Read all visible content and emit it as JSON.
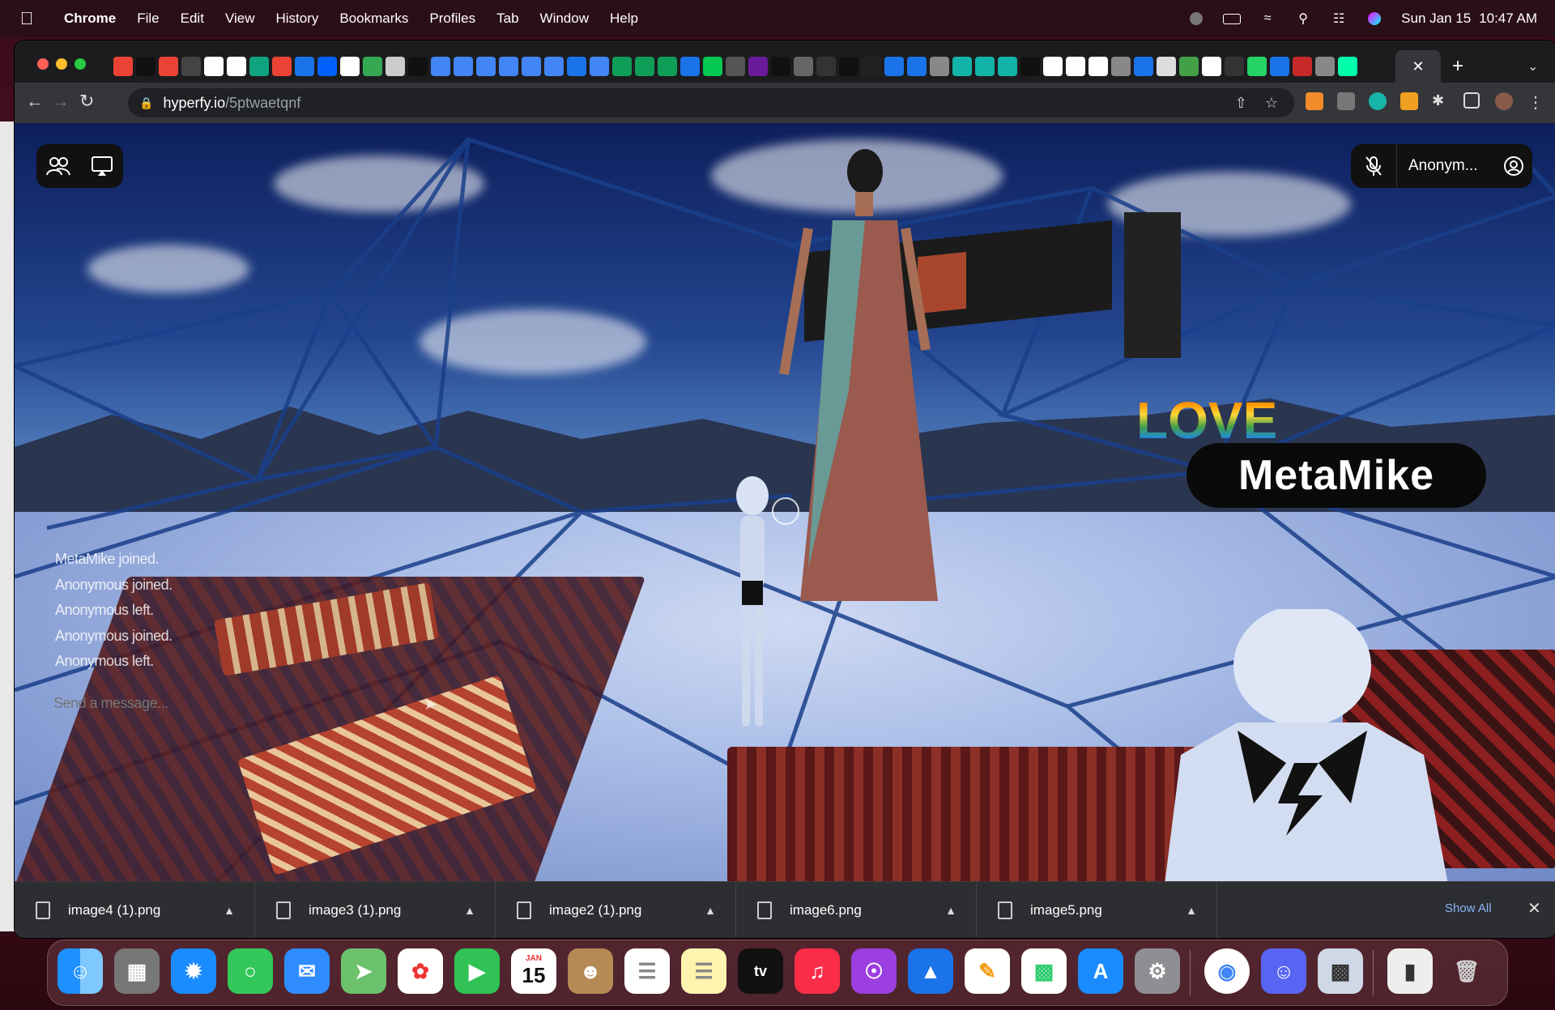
{
  "menubar": {
    "app": "Chrome",
    "items": [
      "File",
      "Edit",
      "View",
      "History",
      "Bookmarks",
      "Profiles",
      "Tab",
      "Window",
      "Help"
    ],
    "date": "Sun Jan 15",
    "time": "10:47 AM"
  },
  "browser": {
    "url_host": "hyperfy.io",
    "url_path": "/5ptwaetqnf"
  },
  "hud": {
    "username": "Anonym..."
  },
  "scene": {
    "nametag": "MetaMike",
    "sign_text": "LOVE"
  },
  "chat": {
    "messages": [
      "MetaMike joined.",
      "Anonymous joined.",
      "Anonymous left.",
      "Anonymous joined.",
      "Anonymous left."
    ],
    "placeholder": "Send a message..."
  },
  "downloads": {
    "items": [
      "image4 (1).png",
      "image3 (1).png",
      "image2 (1).png",
      "image6.png",
      "image5.png"
    ],
    "show_all": "Show All"
  },
  "dock": {
    "calendar_month": "JAN",
    "calendar_day": "15",
    "tv_label": "tv"
  },
  "colors": {
    "menubar_bg": "#2b0f16",
    "chrome_dark": "#202124",
    "link_blue": "#8ab4f8",
    "sky": "#23458f",
    "floor": "#b9c9ec"
  }
}
